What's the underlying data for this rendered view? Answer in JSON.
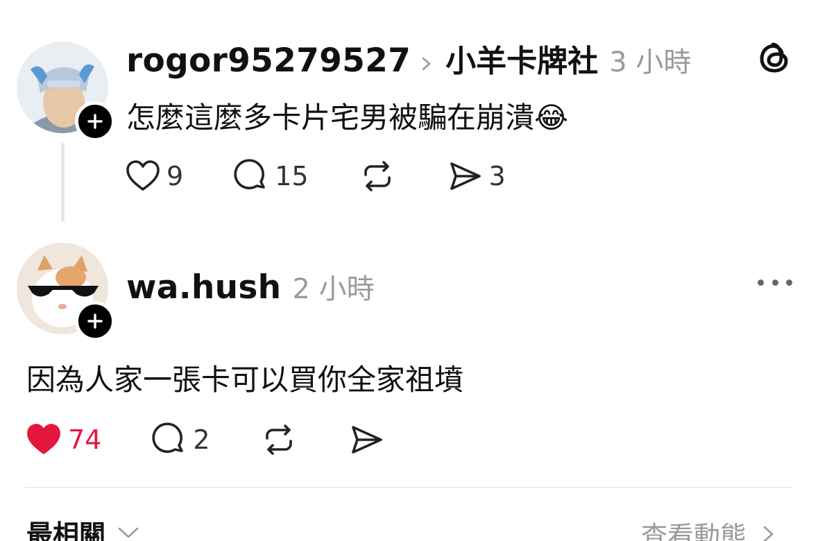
{
  "post1": {
    "username": "rogor95279527",
    "community": "小羊卡牌社",
    "time": "3 小時",
    "text": "怎麼這麼多卡片宅男被騙在崩潰",
    "emoji": "😂",
    "likes": "9",
    "replies": "15",
    "shares": "3"
  },
  "post2": {
    "username": "wa.hush",
    "time": "2 小時",
    "text": "因為人家一張卡可以買你全家祖墳",
    "likes": "74",
    "replies": "2"
  },
  "footer": {
    "sort_label": "最相關",
    "activity_label": "查看動態"
  },
  "colors": {
    "like_active": "#e3173e",
    "muted_text": "#9a9a9a",
    "primary_text": "#111111"
  },
  "icons": {
    "brand": "threads-logo-icon",
    "like": "heart-icon",
    "reply": "comment-icon",
    "repost": "repost-icon",
    "share": "send-icon",
    "more": "more-dots-icon",
    "follow": "plus-icon"
  }
}
